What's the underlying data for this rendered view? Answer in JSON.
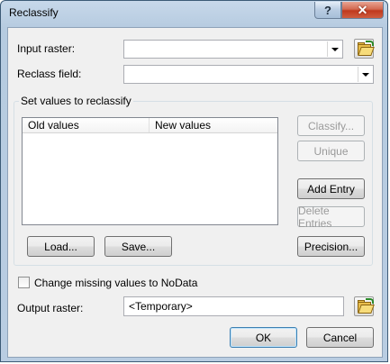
{
  "window": {
    "title": "Reclassify",
    "help_label": "?",
    "close_label": "✕"
  },
  "input_raster": {
    "label": "Input raster:",
    "value": ""
  },
  "reclass_field": {
    "label": "Reclass field:",
    "value": ""
  },
  "reclassify_group": {
    "legend": "Set values to reclassify",
    "table": {
      "columns": [
        "Old values",
        "New values"
      ],
      "rows": []
    },
    "buttons": {
      "classify": "Classify...",
      "unique": "Unique",
      "add_entry": "Add Entry",
      "delete_entries": "Delete Entries",
      "load": "Load...",
      "save": "Save...",
      "precision": "Precision..."
    }
  },
  "missing_values": {
    "label": "Change missing values to NoData",
    "checked": false
  },
  "output_raster": {
    "label": "Output raster:",
    "value": "<Temporary>"
  },
  "footer": {
    "ok": "OK",
    "cancel": "Cancel"
  },
  "icons": {
    "browse": "open-folder-icon",
    "dropdown": "chevron-down-icon"
  }
}
